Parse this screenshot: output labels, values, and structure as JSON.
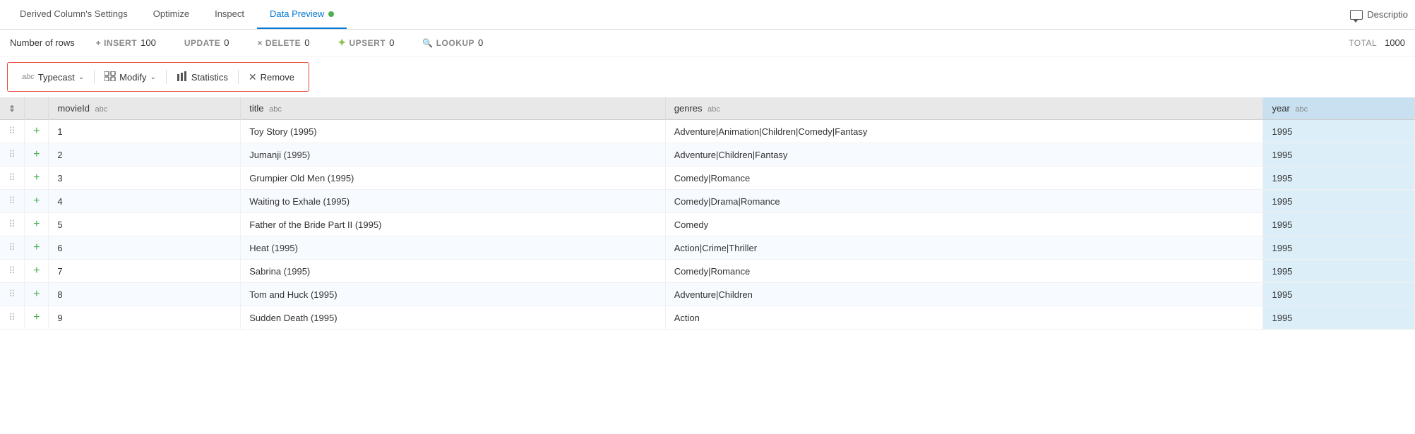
{
  "tabs": [
    {
      "id": "derived-col-settings",
      "label": "Derived Column's Settings",
      "active": false
    },
    {
      "id": "optimize",
      "label": "Optimize",
      "active": false
    },
    {
      "id": "inspect",
      "label": "Inspect",
      "active": false
    },
    {
      "id": "data-preview",
      "label": "Data Preview",
      "active": true
    }
  ],
  "tab_description_label": "Descriptio",
  "stats_label": "Number of rows",
  "stats": {
    "insert_label": "+ INSERT",
    "insert_val": "100",
    "update_label": "UPDATE",
    "update_val": "0",
    "delete_label": "× DELETE",
    "delete_val": "0",
    "upsert_label": "UPSERT",
    "upsert_val": "0",
    "lookup_label": "LOOKUP",
    "lookup_val": "0",
    "total_label": "TOTAL",
    "total_val": "1000"
  },
  "toolbar": {
    "typecast_label": "Typecast",
    "typecast_prefix": "abc",
    "modify_label": "Modify",
    "statistics_label": "Statistics",
    "remove_label": "Remove"
  },
  "table": {
    "columns": [
      {
        "id": "sort",
        "label": "",
        "type": ""
      },
      {
        "id": "add",
        "label": "",
        "type": ""
      },
      {
        "id": "movieid",
        "label": "movieId",
        "type": "abc"
      },
      {
        "id": "title",
        "label": "title",
        "type": "abc"
      },
      {
        "id": "genres",
        "label": "genres",
        "type": "abc"
      },
      {
        "id": "year",
        "label": "year",
        "type": "abc"
      }
    ],
    "rows": [
      {
        "movieid": "1",
        "title": "Toy Story (1995)",
        "genres": "Adventure|Animation|Children|Comedy|Fantasy",
        "year": "1995"
      },
      {
        "movieid": "2",
        "title": "Jumanji (1995)",
        "genres": "Adventure|Children|Fantasy",
        "year": "1995"
      },
      {
        "movieid": "3",
        "title": "Grumpier Old Men (1995)",
        "genres": "Comedy|Romance",
        "year": "1995"
      },
      {
        "movieid": "4",
        "title": "Waiting to Exhale (1995)",
        "genres": "Comedy|Drama|Romance",
        "year": "1995"
      },
      {
        "movieid": "5",
        "title": "Father of the Bride Part II (1995)",
        "genres": "Comedy",
        "year": "1995"
      },
      {
        "movieid": "6",
        "title": "Heat (1995)",
        "genres": "Action|Crime|Thriller",
        "year": "1995"
      },
      {
        "movieid": "7",
        "title": "Sabrina (1995)",
        "genres": "Comedy|Romance",
        "year": "1995"
      },
      {
        "movieid": "8",
        "title": "Tom and Huck (1995)",
        "genres": "Adventure|Children",
        "year": "1995"
      },
      {
        "movieid": "9",
        "title": "Sudden Death (1995)",
        "genres": "Action",
        "year": "1995"
      }
    ]
  }
}
